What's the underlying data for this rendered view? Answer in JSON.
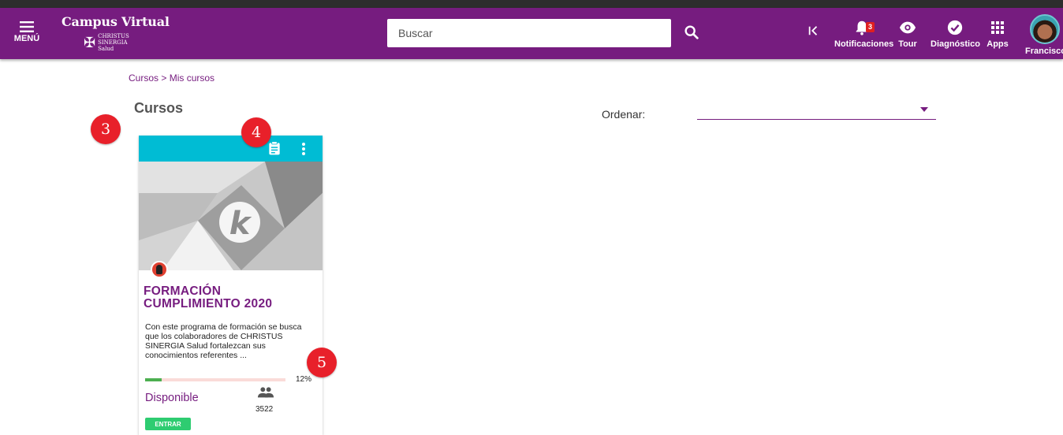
{
  "header": {
    "menu_label": "MENÚ",
    "brand_title": "Campus Virtual",
    "brand_sub_line1": "CHRISTUS",
    "brand_sub_line2": "SINERGIA",
    "brand_sub_line3": "Salud",
    "search_placeholder": "Buscar",
    "notifications_label": "Notificaciones",
    "notifications_count": "3",
    "tour_label": "Tour",
    "diagnostic_label": "Diagnóstico",
    "apps_label": "Apps",
    "user_label": "Francisco"
  },
  "breadcrumb": {
    "item1": "Cursos",
    "separator": " > ",
    "item2": "Mis cursos"
  },
  "page_title": "Cursos",
  "sort": {
    "label": "Ordenar:",
    "value": ""
  },
  "markers": [
    "3",
    "4",
    "5"
  ],
  "course": {
    "title": "FORMACIÓN CUMPLIMIENTO 2020",
    "description": "Con este programa de formación se busca que los colaboradores de CHRISTUS SINERGIA Salud fortalezcan sus conocimientos referentes ...",
    "progress": 12,
    "progress_label": "12%",
    "status": "Disponible",
    "participants": "3522",
    "enter_label": "ENTRAR"
  },
  "colors": {
    "primary": "#761c7f",
    "card_header": "#00bcd4",
    "progress_fill": "#4caf50",
    "enter_button": "#2ecc71",
    "marker": "#e8202a"
  }
}
